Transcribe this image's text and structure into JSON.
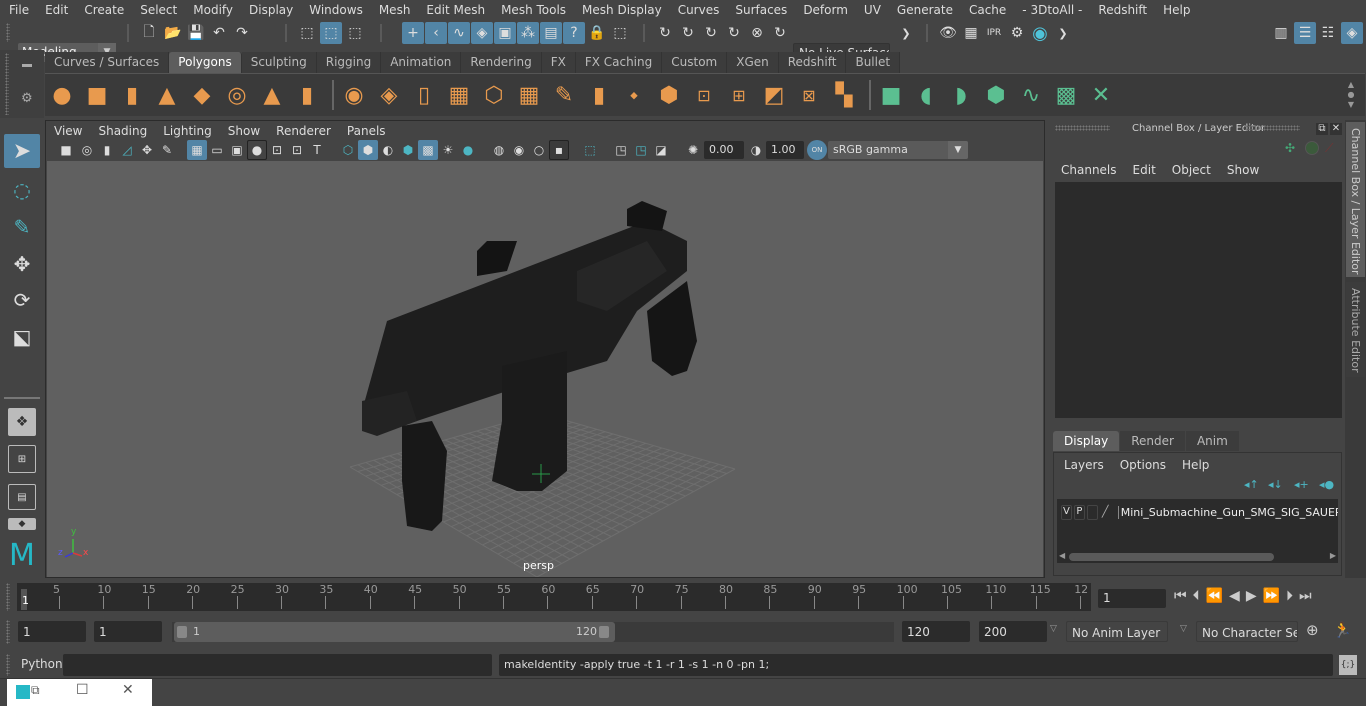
{
  "menubar": {
    "items": [
      "File",
      "Edit",
      "Create",
      "Select",
      "Modify",
      "Display",
      "Windows",
      "Mesh",
      "Edit Mesh",
      "Mesh Tools",
      "Mesh Display",
      "Curves",
      "Surfaces",
      "Deform",
      "UV",
      "Generate",
      "Cache",
      "- 3DtoAll -",
      "Redshift",
      "Help"
    ]
  },
  "statusline": {
    "workspace": "Modeling",
    "live_surface": "No Live Surface"
  },
  "shelf": {
    "tabs": [
      "Curves / Surfaces",
      "Polygons",
      "Sculpting",
      "Rigging",
      "Animation",
      "Rendering",
      "FX",
      "FX Caching",
      "Custom",
      "XGen",
      "Redshift",
      "Bullet"
    ],
    "active_tab": "Polygons"
  },
  "viewport": {
    "menu": [
      "View",
      "Shading",
      "Lighting",
      "Show",
      "Renderer",
      "Panels"
    ],
    "exposure": "0.00",
    "gamma": "1.00",
    "color_space": "sRGB gamma",
    "camera_label": "persp",
    "axis": {
      "x": "x",
      "y": "y",
      "z": "z"
    }
  },
  "channelbox": {
    "title": "Channel Box / Layer Editor",
    "menu": [
      "Channels",
      "Edit",
      "Object",
      "Show"
    ],
    "layer_tabs": [
      "Display",
      "Render",
      "Anim"
    ],
    "active_layer_tab": "Display",
    "layer_menu": [
      "Layers",
      "Options",
      "Help"
    ],
    "layers": [
      {
        "v": "V",
        "p": "P",
        "name": "Mini_Submachine_Gun_SMG_SIG_SAUER_M"
      }
    ]
  },
  "side_tabs": [
    "Channel Box / Layer Editor",
    "Attribute Editor"
  ],
  "timeline": {
    "ticks": [
      "5",
      "10",
      "15",
      "20",
      "25",
      "30",
      "35",
      "40",
      "45",
      "50",
      "55",
      "60",
      "65",
      "70",
      "75",
      "80",
      "85",
      "90",
      "95",
      "100",
      "105",
      "110",
      "115",
      "12"
    ],
    "current_frame_marker": "1",
    "current_frame": "1"
  },
  "range": {
    "start": "1",
    "playback_start": "1",
    "slider_min": "1",
    "slider_max": "120",
    "playback_end": "120",
    "end": "200",
    "anim_layer": "No Anim Layer",
    "character_set": "No Character Set"
  },
  "cmdline": {
    "language": "Python",
    "input": "",
    "result": "makeIdentity -apply true -t 1 -r 1 -s 1 -n 0 -pn 1;"
  }
}
